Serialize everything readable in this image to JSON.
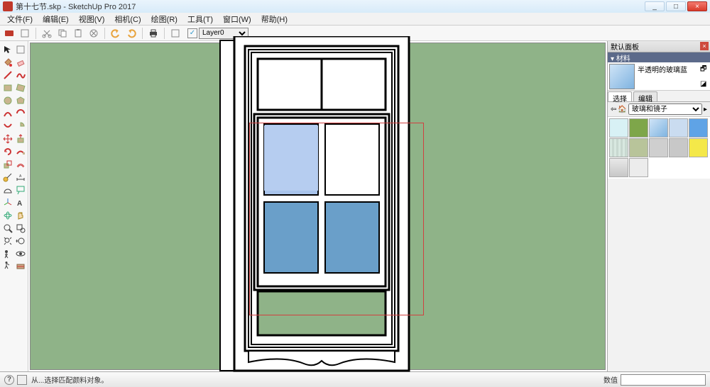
{
  "window": {
    "title": "第十七节.skp - SketchUp Pro 2017",
    "min": "_",
    "max": "□",
    "close": "×"
  },
  "menu": {
    "file": "文件(F)",
    "edit": "编辑(E)",
    "view": "视图(V)",
    "camera": "相机(C)",
    "draw": "绘图(R)",
    "tools": "工具(T)",
    "window": "窗口(W)",
    "help": "帮助(H)"
  },
  "toolbar": {
    "layer_checked": "✓",
    "layer_value": "Layer0"
  },
  "panel": {
    "default_tray": "默认面板",
    "materials": "▾ 材料",
    "material_name": "半透明的玻璃蓝",
    "tab_select": "选择",
    "tab_edit": "编辑",
    "category": "玻璃和镜子",
    "swatches": [
      "#d8f1f5",
      "#7ea64a",
      "#8fb3d6",
      "#cadcf0",
      "#5fa3e6",
      "#d8e8e0",
      "#b8c49a",
      "#cfcfcf",
      "#c8c8c8",
      "#f4e849",
      "#d8d8d8",
      "#ececec"
    ]
  },
  "status": {
    "hint": "从...选择匹配颜料对象。",
    "value_label": "数值"
  }
}
